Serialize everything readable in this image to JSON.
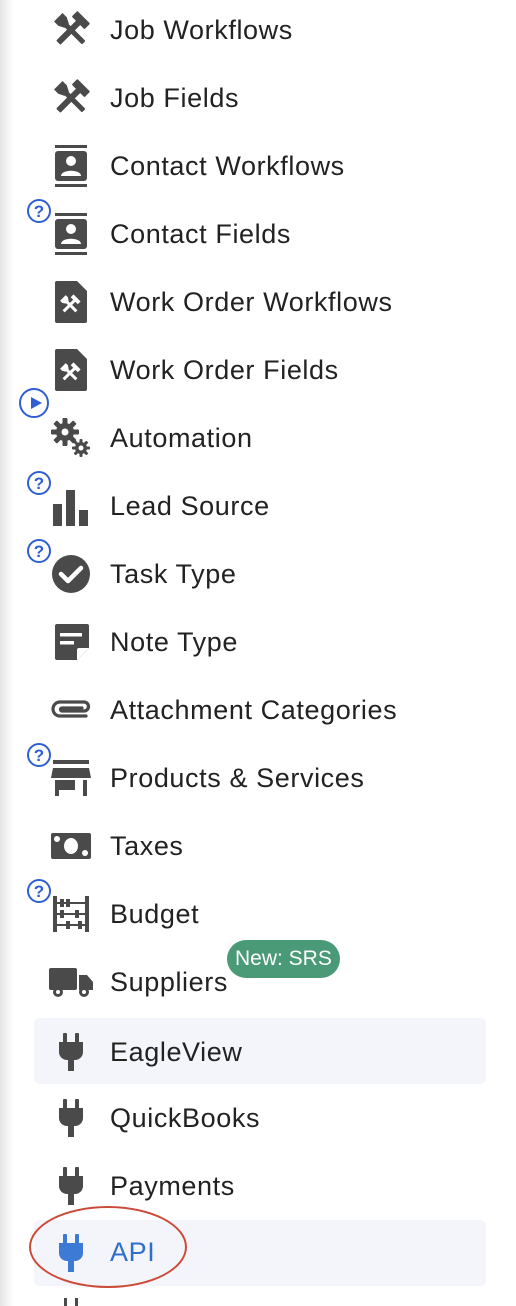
{
  "nav": {
    "items": [
      {
        "label": "Job Workflows",
        "icon": "tools-icon"
      },
      {
        "label": "Job Fields",
        "icon": "tools-icon"
      },
      {
        "label": "Contact Workflows",
        "icon": "contact-card-icon"
      },
      {
        "label": "Contact Fields",
        "icon": "contact-card-icon"
      },
      {
        "label": "Work Order Workflows",
        "icon": "work-order-icon"
      },
      {
        "label": "Work Order Fields",
        "icon": "work-order-icon"
      },
      {
        "label": "Automation",
        "icon": "gears-icon"
      },
      {
        "label": "Lead Source",
        "icon": "bar-chart-icon"
      },
      {
        "label": "Task Type",
        "icon": "check-circle-icon"
      },
      {
        "label": "Note Type",
        "icon": "note-icon"
      },
      {
        "label": "Attachment Categories",
        "icon": "paperclip-icon"
      },
      {
        "label": "Products & Services",
        "icon": "store-icon"
      },
      {
        "label": "Taxes",
        "icon": "money-icon"
      },
      {
        "label": "Budget",
        "icon": "abacus-icon"
      },
      {
        "label": "Suppliers",
        "icon": "truck-icon"
      },
      {
        "label": "EagleView",
        "icon": "plug-icon"
      },
      {
        "label": "QuickBooks",
        "icon": "plug-icon"
      },
      {
        "label": "Payments",
        "icon": "plug-icon"
      },
      {
        "label": "API",
        "icon": "plug-icon"
      }
    ],
    "help_marker": "?",
    "suppliers_badge": "New: SRS"
  },
  "colors": {
    "icon": "#4a4a4a",
    "text": "#222222",
    "active_text": "#2f6fc9",
    "help_blue": "#2f5fd0",
    "badge_green": "#4a9a78",
    "highlight_bg": "#f3f5fa",
    "annotation_red": "#cc4a3a"
  }
}
